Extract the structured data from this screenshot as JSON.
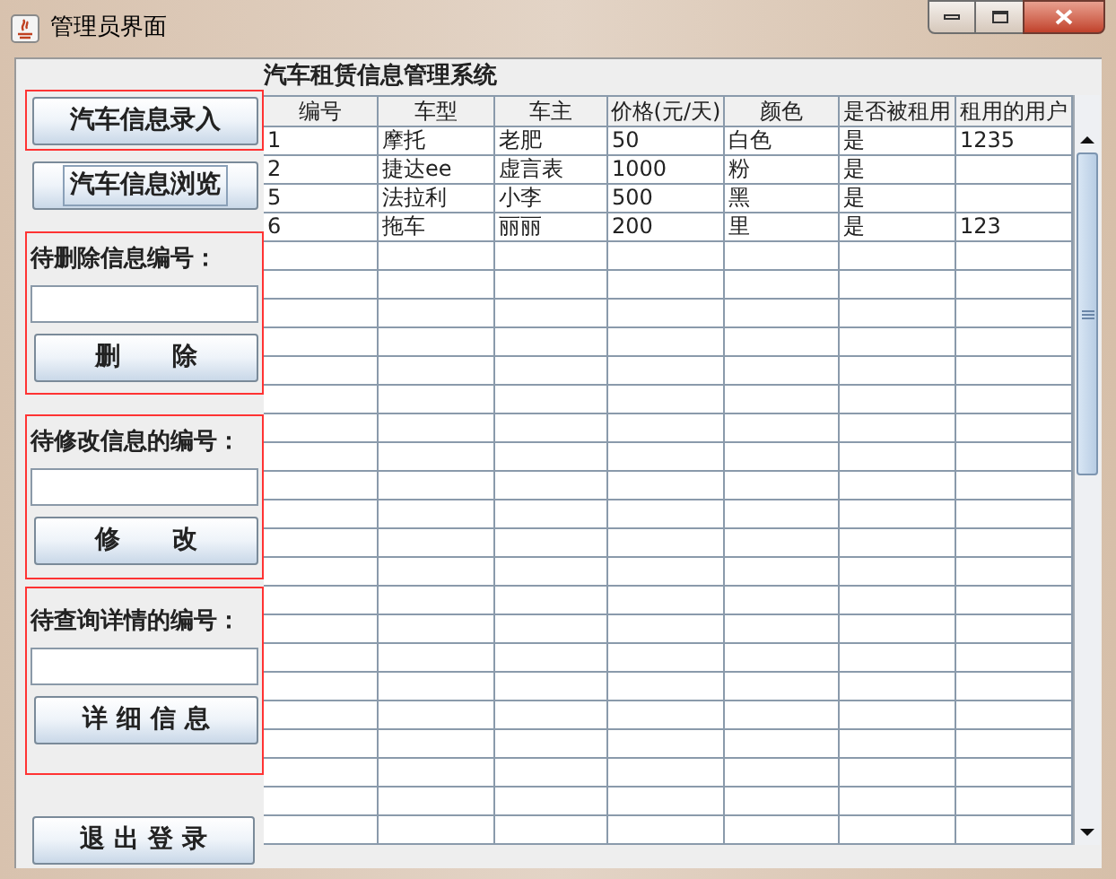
{
  "window": {
    "title": "管理员界面"
  },
  "left_panel": {
    "add_button": "汽车信息录入",
    "browse_button": "汽车信息浏览",
    "groups": [
      {
        "label": "待删除信息编号：",
        "button": "删      除"
      },
      {
        "label": "待修改信息的编号：",
        "button": "修      改"
      },
      {
        "label": "待查询详情的编号：",
        "button": "详 细 信 息"
      }
    ],
    "logout_button": "退 出 登 录"
  },
  "table": {
    "title": "汽车租赁信息管理系统",
    "columns": [
      "编号",
      "车型",
      "车主",
      "价格(元/天)",
      "颜色",
      "是否被租用",
      "租用的用户"
    ],
    "rows": [
      [
        "1",
        "摩托",
        "老肥",
        "50",
        "白色",
        "是",
        "1235"
      ],
      [
        "2",
        "捷达ee",
        "虚言表",
        "1000",
        "粉",
        "是",
        ""
      ],
      [
        "5",
        "法拉利",
        "小李",
        "500",
        "黑",
        "是",
        ""
      ],
      [
        "6",
        "拖车",
        "丽丽",
        "200",
        "里",
        "是",
        "123"
      ]
    ]
  }
}
